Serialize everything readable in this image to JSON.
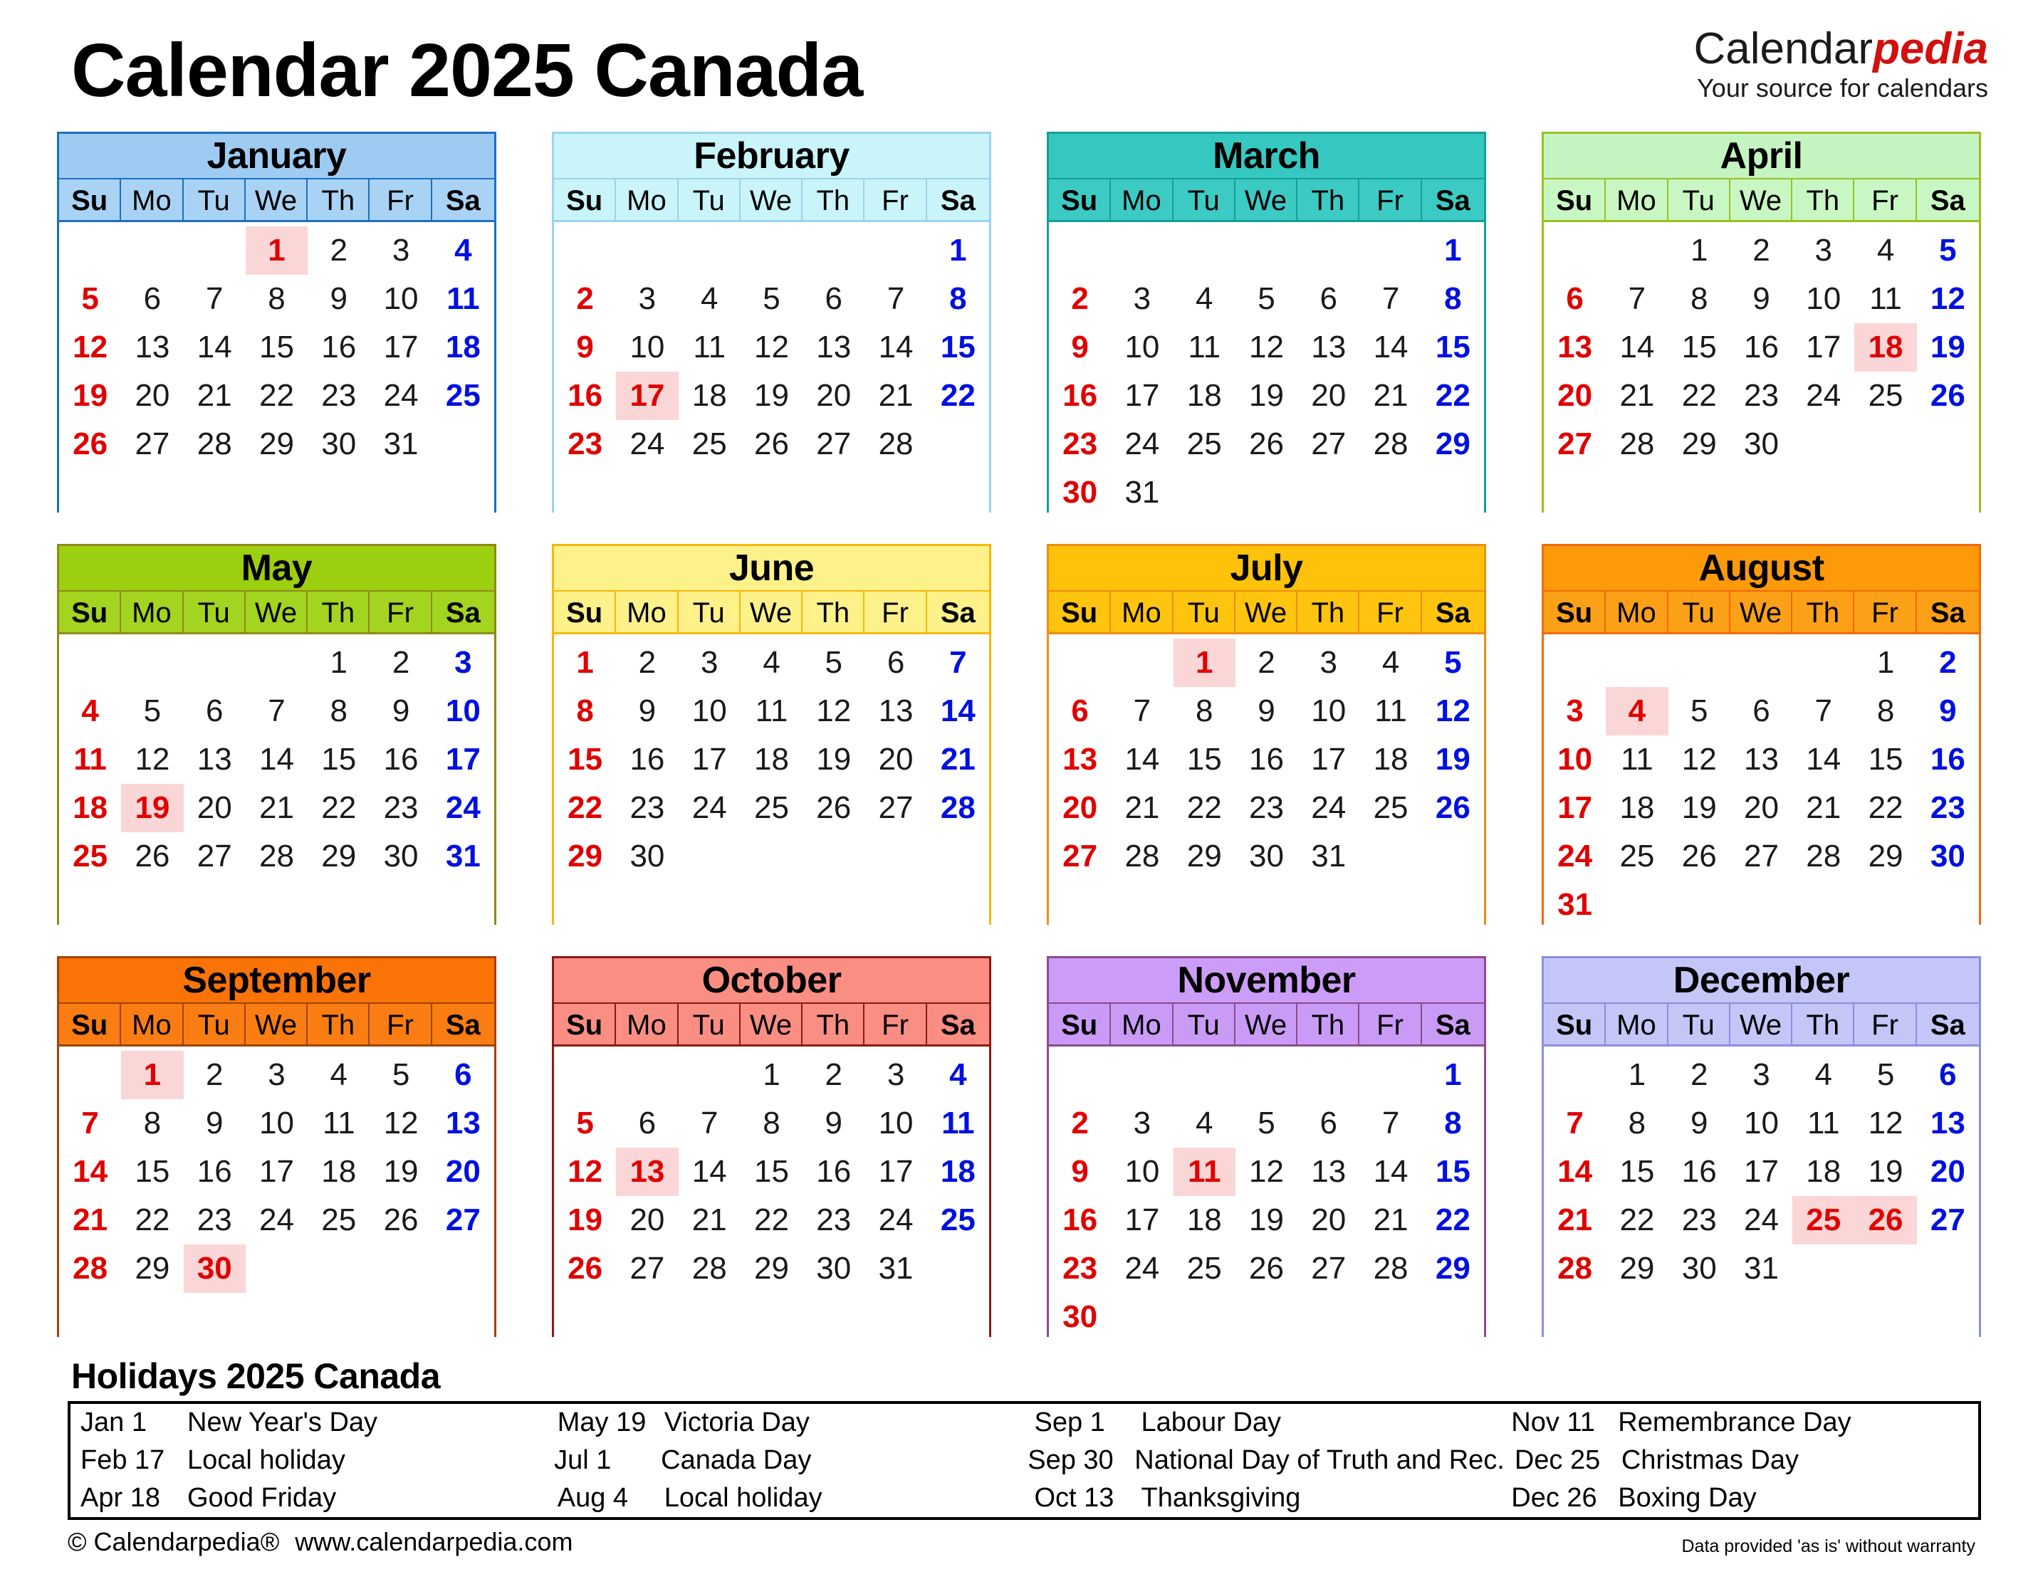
{
  "header": {
    "title": "Calendar 2025 Canada",
    "brand_part1": "Calendar",
    "brand_part2": "pedia",
    "tagline": "Your source for calendars"
  },
  "dow": [
    "Su",
    "Mo",
    "Tu",
    "We",
    "Th",
    "Fr",
    "Sa"
  ],
  "colors": {
    "sunday": "#e00000",
    "saturday": "#0010e0",
    "holiday_bg": "#fbd6d6",
    "brand_accent": "#d0110f"
  },
  "months": [
    {
      "name": "January",
      "header_bg": "#9ecbf2",
      "dow_bg": "#a9d3f5",
      "border": "#1b6fc4",
      "lead": 3,
      "days": 31,
      "holidays": [
        1
      ]
    },
    {
      "name": "February",
      "header_bg": "#c9f5fa",
      "dow_bg": "#c9f5fa",
      "border": "#9bd2ee",
      "lead": 6,
      "days": 28,
      "holidays": [
        17
      ]
    },
    {
      "name": "March",
      "header_bg": "#34c8c0",
      "dow_bg": "#3bcbc4",
      "border": "#159e97",
      "lead": 6,
      "days": 31,
      "holidays": []
    },
    {
      "name": "April",
      "header_bg": "#c4f5c0",
      "dow_bg": "#c8f7c4",
      "border": "#9ac022",
      "lead": 2,
      "days": 30,
      "holidays": [
        18
      ]
    },
    {
      "name": "May",
      "header_bg": "#9ccf10",
      "dow_bg": "#a3d420",
      "border": "#8f8a14",
      "lead": 4,
      "days": 31,
      "holidays": [
        19
      ]
    },
    {
      "name": "June",
      "header_bg": "#fdf18a",
      "dow_bg": "#fdf18a",
      "border": "#f6b70a",
      "lead": 0,
      "days": 30,
      "holidays": []
    },
    {
      "name": "July",
      "header_bg": "#ffc20a",
      "dow_bg": "#ffc40d",
      "border": "#f08c14",
      "lead": 2,
      "days": 31,
      "holidays": [
        1
      ]
    },
    {
      "name": "August",
      "header_bg": "#fc9a0a",
      "dow_bg": "#fca018",
      "border": "#ef6b10",
      "lead": 5,
      "days": 31,
      "holidays": [
        4
      ]
    },
    {
      "name": "September",
      "header_bg": "#f97306",
      "dow_bg": "#f97d12",
      "border": "#a2420a",
      "lead": 1,
      "days": 30,
      "holidays": [
        1,
        30
      ]
    },
    {
      "name": "October",
      "header_bg": "#fa8e83",
      "dow_bg": "#fa8e83",
      "border": "#8f1812",
      "lead": 3,
      "days": 31,
      "holidays": [
        13
      ]
    },
    {
      "name": "November",
      "header_bg": "#cc9df8",
      "dow_bg": "#c99bf7",
      "border": "#8e4a8d",
      "lead": 6,
      "days": 30,
      "holidays": [
        11
      ]
    },
    {
      "name": "December",
      "header_bg": "#c3c6f7",
      "dow_bg": "#c3c6f7",
      "border": "#8c8fe0",
      "lead": 1,
      "days": 31,
      "holidays": [
        25,
        26
      ]
    }
  ],
  "holidays_section": {
    "title": "Holidays 2025 Canada",
    "entries": [
      {
        "date": "Jan 1",
        "name": "New Year's Day"
      },
      {
        "date": "May 19",
        "name": "Victoria Day"
      },
      {
        "date": "Sep 1",
        "name": "Labour Day"
      },
      {
        "date": "Nov 11",
        "name": "Remembrance Day"
      },
      {
        "date": "Feb 17",
        "name": "Local holiday"
      },
      {
        "date": "Jul 1",
        "name": "Canada Day"
      },
      {
        "date": "Sep 30",
        "name": "National Day of Truth and Rec."
      },
      {
        "date": "Dec 25",
        "name": "Christmas Day"
      },
      {
        "date": "Apr 18",
        "name": "Good Friday"
      },
      {
        "date": "Aug 4",
        "name": "Local holiday"
      },
      {
        "date": "Oct 13",
        "name": "Thanksgiving"
      },
      {
        "date": "Dec 26",
        "name": "Boxing Day"
      }
    ]
  },
  "footer": {
    "copyright": "© Calendarpedia®",
    "website": "www.calendarpedia.com",
    "warranty": "Data provided 'as is' without warranty"
  }
}
